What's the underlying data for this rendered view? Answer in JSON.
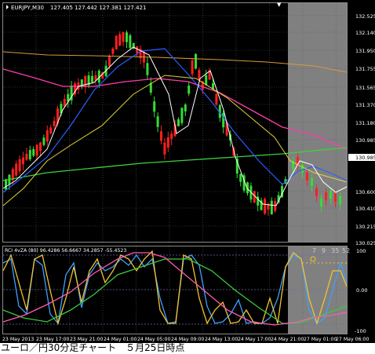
{
  "header": {
    "symbol_timeframe": "EURJPY,M30",
    "ohlc": "127.405 127.442 127.381 127.421"
  },
  "price_axis": [
    "132.525",
    "132.140",
    "131.950",
    "131.755",
    "131.565",
    "131.370",
    "131.180",
    "130.985",
    "130.600",
    "130.410",
    "130.215",
    "130.025"
  ],
  "current_price_label": "130.985",
  "indicator": {
    "header": "RCI 4vZA (80) 96.4286 56.6667 34.2857 -55.4523",
    "axis_labels": [
      "100",
      "0.00",
      "-100"
    ],
    "overlay_numbers": [
      "7",
      "9",
      "35",
      "52"
    ]
  },
  "time_axis": [
    "23 May 2013",
    "23 May 17:00",
    "23 May 21:00",
    "24 May 01:00",
    "24 May 05:00",
    "24 May 09:00",
    "24 May 13:00",
    "24 May 17:00",
    "24 May 21:00",
    "27 May 01:00",
    "27 May 06:00"
  ],
  "caption": "ユーロ／円30分足チャート　５月25日時点",
  "colors": {
    "background": "#000000",
    "grid": "#5a5a5a",
    "bull_candle": "#33dd33",
    "bear_candle": "#ff1f1f",
    "future_shade": "#808080",
    "ma_orange": "#d89a3c",
    "ma_magenta": "#ff3ca8",
    "ma_green": "#3cd23c",
    "ma_blue": "#2a5cff",
    "ma_yellow": "#e4d23a",
    "ma_white": "#ffffff",
    "rci_blue": "#3ea0ff",
    "rci_yellow": "#f2c230",
    "rci_green": "#3cc83c",
    "rci_pink": "#ff5ab4"
  }
}
